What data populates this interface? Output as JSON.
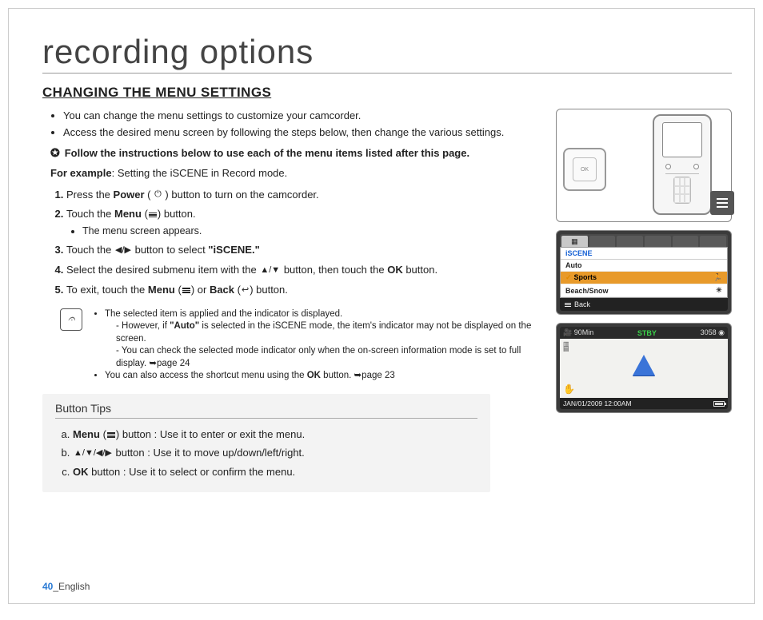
{
  "page_title": "recording options",
  "section_heading": "CHANGING THE MENU SETTINGS",
  "intro_bullets": [
    "You can change the menu settings to customize your camcorder.",
    "Access the desired menu screen by following the steps below, then change the various settings."
  ],
  "instruction_bold": "Follow the instructions below to use each of the menu items listed after this page.",
  "example_label": "For example",
  "example_text": ": Setting the iSCENE in Record mode.",
  "steps": {
    "s1a": "Press the ",
    "s1b": "Power",
    "s1c": " ( ",
    "s1d": " ) button to turn on the camcorder.",
    "s2a": "Touch the ",
    "s2b": "Menu",
    "s2c": " (",
    "s2d": ") button.",
    "s2sub": "The menu screen appears.",
    "s3a": "Touch the ",
    "s3b": " button to select ",
    "s3c": "\"iSCENE.\"",
    "s4a": "Select the desired submenu item with the ",
    "s4b": " button, then touch the ",
    "s4c": "OK",
    "s4d": " button.",
    "s5a": "To exit, touch the ",
    "s5b": "Menu",
    "s5c": " (",
    "s5d": ") or ",
    "s5e": "Back",
    "s5f": " (",
    "s5g": ") button."
  },
  "notes": {
    "n1": "The selected item is applied and the indicator is displayed.",
    "n1a_pre": "However, if ",
    "n1a_bold": "\"Auto\"",
    "n1a_post": " is selected in the iSCENE mode, the item's indicator may not be displayed on the screen.",
    "n1b": "You can check the selected mode indicator only when the on-screen information mode is set to full display. ➥page 24",
    "n2": "You can also access the shortcut menu using the ",
    "n2b": "OK",
    "n2c": " button. ➥page 23"
  },
  "tips": {
    "heading": "Button Tips",
    "a_pre": "Menu",
    "a_mid": " (",
    "a_post": ") button : Use it to enter or exit the menu.",
    "b": " button : Use it to move up/down/left/right.",
    "c_pre": "OK",
    "c_post": " button : Use it to select or confirm the menu."
  },
  "footer": {
    "page": "40",
    "sep": "_",
    "lang": "English"
  },
  "lcd_menu": {
    "title": "iSCENE",
    "items": [
      "Auto",
      "Sports",
      "Beach/Snow"
    ],
    "selected_index": 1,
    "back": "Back"
  },
  "lcd_preview": {
    "time_remaining": "90Min",
    "status": "STBY",
    "counter": "3058",
    "timestamp": "JAN/01/2009 12:00AM"
  },
  "remote_label": "OK"
}
